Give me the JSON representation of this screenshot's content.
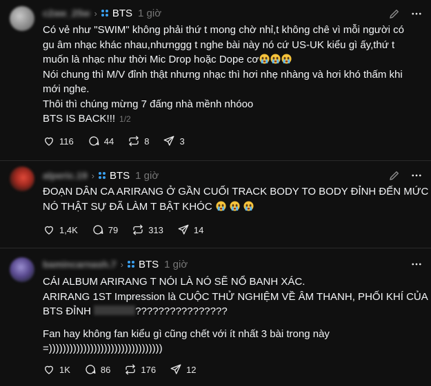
{
  "posts": [
    {
      "username": "c2aw_25w",
      "topic": "BTS",
      "time": "1 giờ",
      "lines": [
        "Có vẻ như \"SWIM\" không phải thứ t mong chờ nhỉ,t không chê vì mỗi người có",
        "gu âm nhạc khác nhau,nhưnggg t nghe bài này nó cứ US-UK kiểu gì ấy,thứ t",
        "muốn là nhạc như thời Mic Drop hoặc Dope cơ",
        "Nói chung thì M/V đỉnh thật nhưng nhạc thì hơi nhẹ nhàng và hơi khó thấm khi",
        "mới nghe.",
        "Thôi thì chúng mừng 7 đấng nhà mềnh nhóoo",
        "BTS IS BACK!!!"
      ],
      "pager": "1/2",
      "likes": "116",
      "comments": "44",
      "reposts": "8",
      "shares": "3"
    },
    {
      "username": "alperic.19",
      "topic": "BTS",
      "time": "1 giờ",
      "lines": [
        "ĐOẠN DÂN CA ARIRANG Ở GẦN CUỐI TRACK BODY TO BODY ĐỈNH ĐẾN MỨC",
        "NÓ THẬT SỰ ĐÃ LÀM T BẬT KHÓC"
      ],
      "likes": "1,4K",
      "comments": "79",
      "reposts": "313",
      "shares": "14"
    },
    {
      "username": "bamincarnash.7",
      "topic": "BTS",
      "time": "1 giờ",
      "lines": [
        "CÁI ALBUM ARIRANG T NÓI LÀ NÓ SẼ NỔ BANH XÁC.",
        "ARIRANG 1ST Impression là CUỘC THỬ NGHIỆM VỀ ÂM THANH, PHỐI KHÍ CỦA",
        "BTS ĐỈNH ",
        "????????????????"
      ],
      "lines2": [
        "Fan hay không fan kiểu gì cũng chết với ít nhất 3 bài trong này",
        "=)))))))))))))))))))))))))))))))))"
      ],
      "likes": "1K",
      "comments": "86",
      "reposts": "176",
      "shares": "12"
    }
  ],
  "colors": {
    "background": "#101010",
    "text": "#f3f5f7",
    "muted": "#777777",
    "tag_blue": "#3aa0f0"
  }
}
